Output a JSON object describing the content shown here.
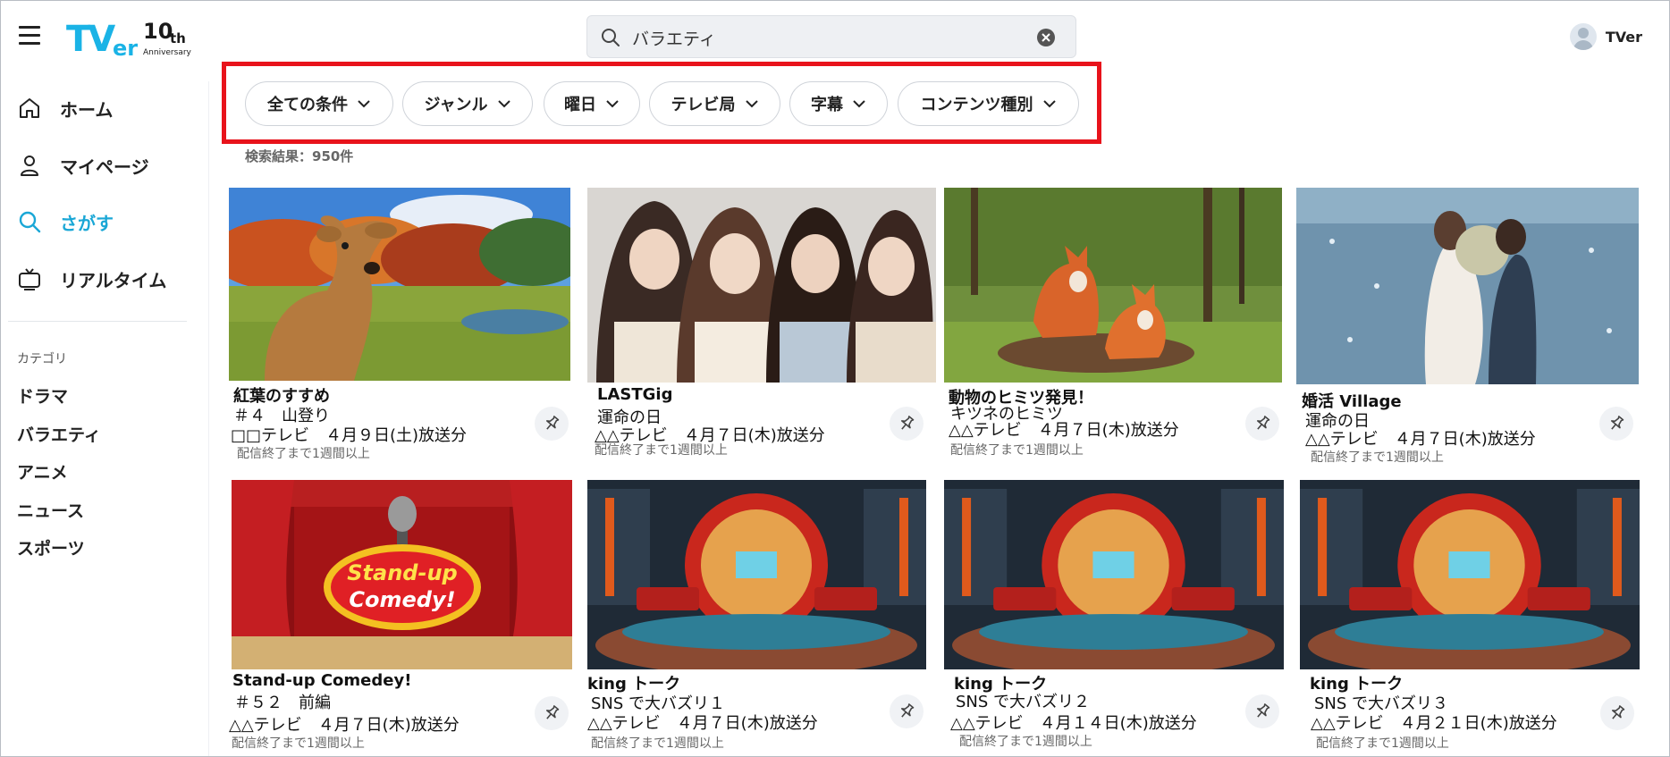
{
  "header": {
    "logo_text": "TVer",
    "logo_anniv_main": "10th",
    "logo_anniv_sub": "Anniversary",
    "search_value": "バラエティ",
    "user_name": "TVer"
  },
  "sidebar": {
    "items": [
      {
        "label": "ホーム",
        "icon": "home-icon"
      },
      {
        "label": "マイページ",
        "icon": "person-icon"
      },
      {
        "label": "さがす",
        "icon": "search-icon"
      },
      {
        "label": "リアルタイム",
        "icon": "tv-icon"
      }
    ],
    "category_title": "カテゴリ",
    "categories": [
      "ドラマ",
      "バラエティ",
      "アニメ",
      "ニュース",
      "スポーツ"
    ]
  },
  "filters": [
    "全ての条件",
    "ジャンル",
    "曜日",
    "テレビ局",
    "字幕",
    "コンテンツ種別"
  ],
  "result_count": "検索結果：950件",
  "cards": [
    {
      "title": "紅葉のすすめ",
      "episode": "＃４　山登り",
      "broadcast": "□□テレビ　４月９日(土)放送分",
      "note": "配信終了まで1週間以上",
      "image": "autumn-deer"
    },
    {
      "title": "LASTGig",
      "episode": "運命の日",
      "broadcast": "△△テレビ　４月７日(木)放送分",
      "note": "配信終了まで1週間以上",
      "image": "four-women"
    },
    {
      "title": "動物のヒミツ発見！",
      "episode": "キツネのヒミツ",
      "broadcast": "△△テレビ　４月７日(木)放送分",
      "note": "配信終了まで1週間以上",
      "image": "foxes"
    },
    {
      "title": "婚活 Village",
      "episode": "運命の日",
      "broadcast": "△△テレビ　４月７日(木)放送分",
      "note": "配信終了まで1週間以上",
      "image": "couple-water"
    },
    {
      "title": "Stand-up Comedey!",
      "episode": "＃５２　前編",
      "broadcast": "△△テレビ　４月７日(木)放送分",
      "note": "配信終了まで1週間以上",
      "image": "comedy-stage"
    },
    {
      "title": "king トーク",
      "episode": "SNS で大バズリ１",
      "broadcast": "△△テレビ　４月７日(木)放送分",
      "note": "配信終了まで1週間以上",
      "image": "talk-studio"
    },
    {
      "title": "king トーク",
      "episode": "SNS で大バズリ２",
      "broadcast": "△△テレビ　４月１４日(木)放送分",
      "note": "配信終了まで1週間以上",
      "image": "talk-studio"
    },
    {
      "title": "king トーク",
      "episode": "SNS で大バズリ３",
      "broadcast": "△△テレビ　４月２１日(木)放送分",
      "note": "配信終了まで1週間以上",
      "image": "talk-studio"
    }
  ],
  "colors": {
    "accent": "#1aa7d6",
    "highlight": "#e8131b",
    "logo_blue": "#1ab3e6"
  }
}
